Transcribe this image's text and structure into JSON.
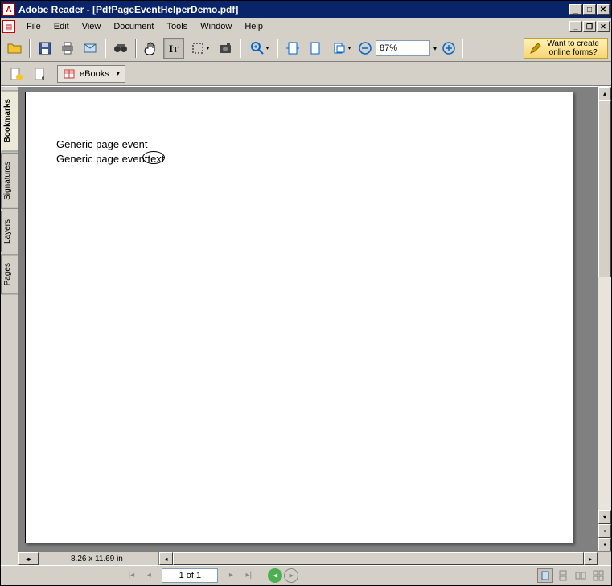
{
  "title": "Adobe Reader - [PdfPageEventHelperDemo.pdf]",
  "menu": {
    "file": "File",
    "edit": "Edit",
    "view": "View",
    "document": "Document",
    "tools": "Tools",
    "window": "Window",
    "help": "Help"
  },
  "toolbar": {
    "zoom_value": "87%"
  },
  "forms_promo": {
    "line1": "Want to create",
    "line2": "online forms?"
  },
  "toolbar2": {
    "ebooks": "eBooks"
  },
  "sidebar": {
    "tabs": [
      "Bookmarks",
      "Signatures",
      "Layers",
      "Pages"
    ]
  },
  "document": {
    "line1": "Generic page event",
    "line2_a": "Generic page event",
    "line2_b": "text"
  },
  "status": {
    "page_size": "8.26 x 11.69 in",
    "page_indicator": "1 of 1"
  }
}
